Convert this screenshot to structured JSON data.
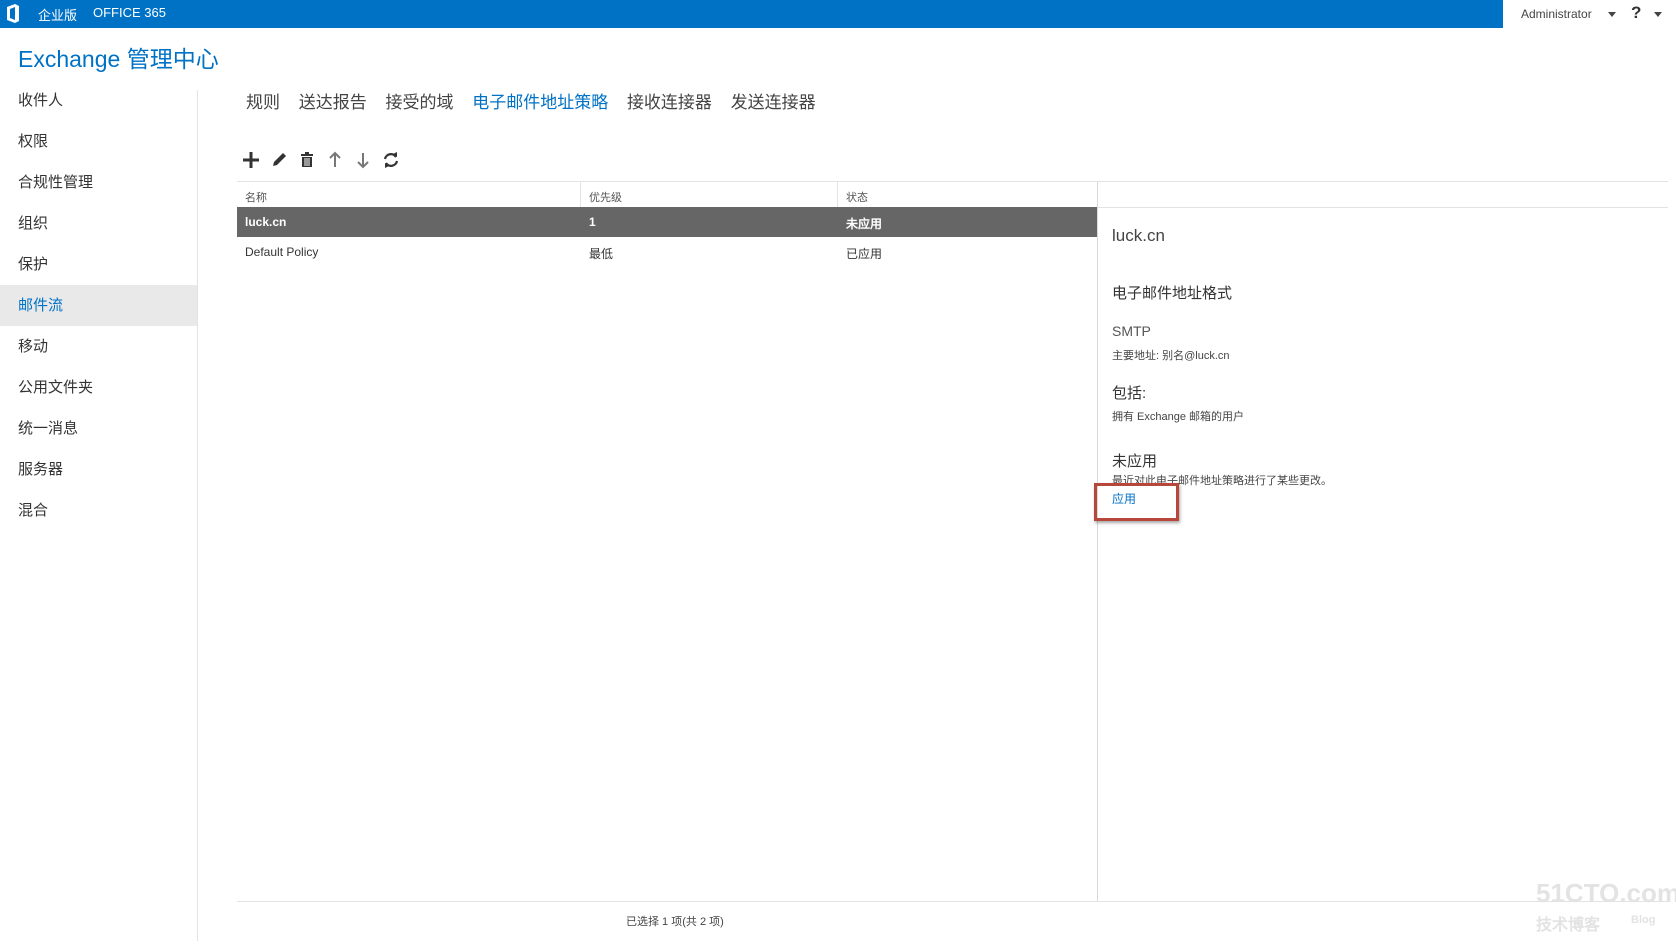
{
  "topbar": {
    "edition": "企业版",
    "product": "OFFICE 365",
    "user": "Administrator",
    "help": "?",
    "logo_icon": "office-logo-icon"
  },
  "app_title": "Exchange 管理中心",
  "sidebar": {
    "items": [
      {
        "label": "收件人"
      },
      {
        "label": "权限"
      },
      {
        "label": "合规性管理"
      },
      {
        "label": "组织"
      },
      {
        "label": "保护"
      },
      {
        "label": "邮件流",
        "active": true
      },
      {
        "label": "移动"
      },
      {
        "label": "公用文件夹"
      },
      {
        "label": "统一消息"
      },
      {
        "label": "服务器"
      },
      {
        "label": "混合"
      }
    ]
  },
  "tabs": [
    "规则",
    "送达报告",
    "接受的域",
    "电子邮件地址策略",
    "接收连接器",
    "发送连接器"
  ],
  "active_tab": "电子邮件地址策略",
  "toolbar": {
    "icons": [
      "add-icon",
      "edit-icon",
      "delete-icon",
      "move-up-icon",
      "move-down-icon",
      "refresh-icon"
    ]
  },
  "table": {
    "columns": [
      "名称",
      "优先级",
      "状态"
    ],
    "rows": [
      {
        "name": "luck.cn",
        "priority": "1",
        "status": "未应用",
        "selected": true
      },
      {
        "name": "Default Policy",
        "priority": "最低",
        "status": "已应用",
        "selected": false
      }
    ]
  },
  "details": {
    "title": "luck.cn",
    "format_heading": "电子邮件地址格式",
    "smtp": "SMTP",
    "primary": "主要地址: 别名@luck.cn",
    "include_heading": "包括:",
    "include_text": "拥有 Exchange 邮箱的用户",
    "status_heading": "未应用",
    "status_text": "最近对此电子邮件地址策略进行了某些更改。",
    "apply_link": "应用"
  },
  "footer": "已选择 1 项(共 2 项)",
  "watermark": {
    "line1": "51CTO.com",
    "line2": "技术博客",
    "line3": "Blog"
  },
  "colors": {
    "brand": "#0072c6",
    "selected_row": "#666666",
    "highlight_box": "#b7473a"
  }
}
